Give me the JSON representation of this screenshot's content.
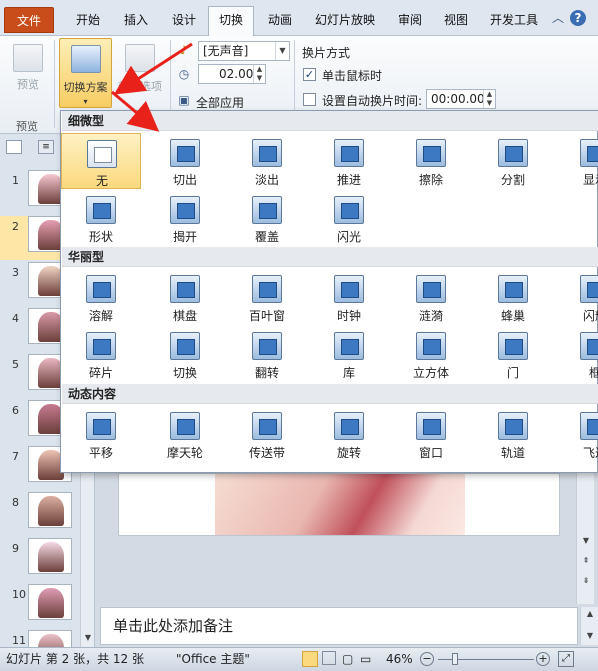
{
  "tabs": [
    "文件",
    "开始",
    "插入",
    "设计",
    "切换",
    "动画",
    "幻灯片放映",
    "审阅",
    "视图",
    "开发工具"
  ],
  "ribbon": {
    "preview_label": "预览",
    "preview_group": "预览",
    "scheme_label": "切换方案",
    "effect_label": "效果选项",
    "sound_value": "[无声音]",
    "duration_value": "02.00",
    "apply_all_label": "全部应用",
    "advance_group": "换片方式",
    "on_click_label": "单击鼠标时",
    "auto_advance_label": "设置自动换片时间:",
    "auto_time_value": "00:00.00"
  },
  "gallery": {
    "sections": [
      {
        "title": "细微型",
        "items": [
          "无",
          "切出",
          "淡出",
          "推进",
          "擦除",
          "分割",
          "显示",
          "形状",
          "揭开",
          "覆盖",
          "闪光"
        ]
      },
      {
        "title": "华丽型",
        "items": [
          "溶解",
          "棋盘",
          "百叶窗",
          "时钟",
          "涟漪",
          "蜂巢",
          "闪耀",
          "碎片",
          "切换",
          "翻转",
          "库",
          "立方体",
          "门",
          "框"
        ]
      },
      {
        "title": "动态内容",
        "items": [
          "平移",
          "摩天轮",
          "传送带",
          "旋转",
          "窗口",
          "轨道",
          "飞过"
        ]
      }
    ]
  },
  "slides": [
    "1",
    "2",
    "3",
    "4",
    "5",
    "6",
    "7",
    "8",
    "9",
    "10",
    "11"
  ],
  "notes_placeholder": "单击此处添加备注",
  "status": {
    "slide_info": "幻灯片 第 2 张，共 12 张",
    "theme": "\"Office 主题\"",
    "zoom": "46%"
  },
  "colors": {
    "file_tab": "#c94d1a",
    "accent_arrow": "#e8221b",
    "selection": "#fbd97e"
  }
}
